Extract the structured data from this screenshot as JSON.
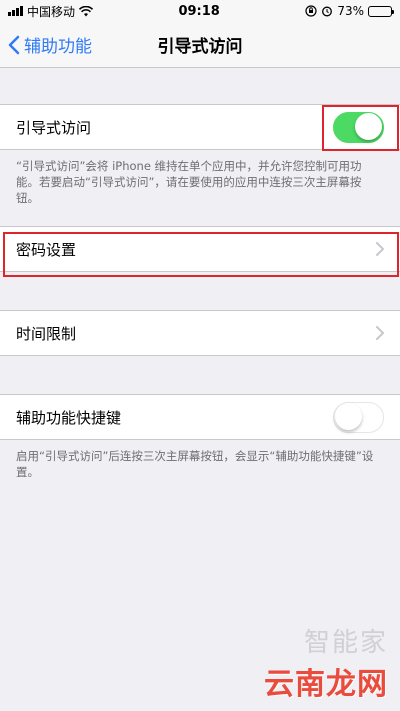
{
  "status": {
    "carrier": "中国移动",
    "time": "09:18",
    "battery": "73%",
    "battery_level": 0.73
  },
  "nav": {
    "back_label": "辅助功能",
    "title": "引导式访问"
  },
  "guided_access": {
    "label": "引导式访问",
    "enabled": true,
    "footnote": "“引导式访问”会将 iPhone 维持在单个应用中，并允许您控制可用功能。若要启动“引导式访问”，请在要使用的应用中连按三次主屏幕按钮。"
  },
  "passcode": {
    "label": "密码设置"
  },
  "time_limits": {
    "label": "时间限制"
  },
  "accessibility_shortcut": {
    "label": "辅助功能快捷键",
    "enabled": false,
    "footnote": "启用“引导式访问”后连按三次主屏幕按钮，会显示“辅助功能快捷键”设置。"
  },
  "watermark": {
    "top": "智能家",
    "bottom": "云南龙网"
  },
  "colors": {
    "accent": "#2f7bf6",
    "toggle_on": "#4cd964",
    "highlight": "#e0242b",
    "background": "#efeff4"
  }
}
